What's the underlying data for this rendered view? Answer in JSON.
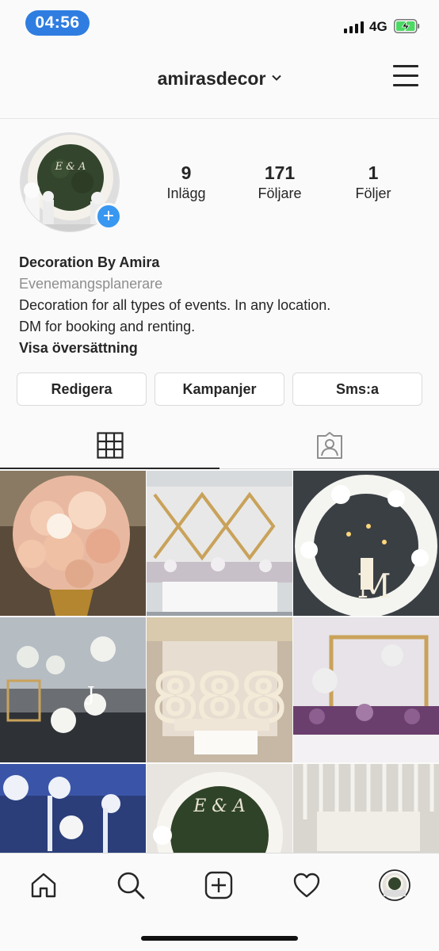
{
  "status_bar": {
    "time": "04:56",
    "network": "4G",
    "icons": [
      "signal-icon",
      "battery-charging-icon"
    ]
  },
  "header": {
    "username": "amirasdecor",
    "icons": [
      "chevron-down-icon",
      "hamburger-menu-icon"
    ]
  },
  "profile": {
    "stats": [
      {
        "value": "9",
        "label": "Inlägg"
      },
      {
        "value": "171",
        "label": "Följare"
      },
      {
        "value": "1",
        "label": "Följer"
      }
    ],
    "add_badge": "+",
    "name": "Decoration By Amira",
    "category": "Evenemangsplanerare",
    "bio_line1": "Decoration for all types of events. In any location.",
    "bio_line2": "DM for booking and renting.",
    "translate": "Visa översättning"
  },
  "actions": {
    "edit": "Redigera",
    "promote": "Kampanjer",
    "sms": "Sms:a"
  },
  "tabs": {
    "icons": [
      "grid-icon",
      "tagged-icon"
    ],
    "active": "grid"
  },
  "posts": [
    {
      "subject": "pink-rose-centerpiece"
    },
    {
      "subject": "gold-diamond-backdrop"
    },
    {
      "subject": "floral-arch-candles"
    },
    {
      "subject": "white-floral-aisle"
    },
    {
      "subject": "floral-number-888"
    },
    {
      "subject": "gold-frame-purple-flowers"
    },
    {
      "subject": "blue-lit-hall"
    },
    {
      "subject": "greenery-floral-circle"
    },
    {
      "subject": "hanging-white-flowers"
    }
  ],
  "bottom_nav": {
    "icons": [
      "home-icon",
      "search-icon",
      "add-post-icon",
      "heart-icon",
      "profile-avatar-icon"
    ]
  },
  "colors": {
    "accent_blue": "#3897f0",
    "time_pill": "#2f7de1",
    "text": "#262626",
    "muted": "#8e8e8e"
  }
}
